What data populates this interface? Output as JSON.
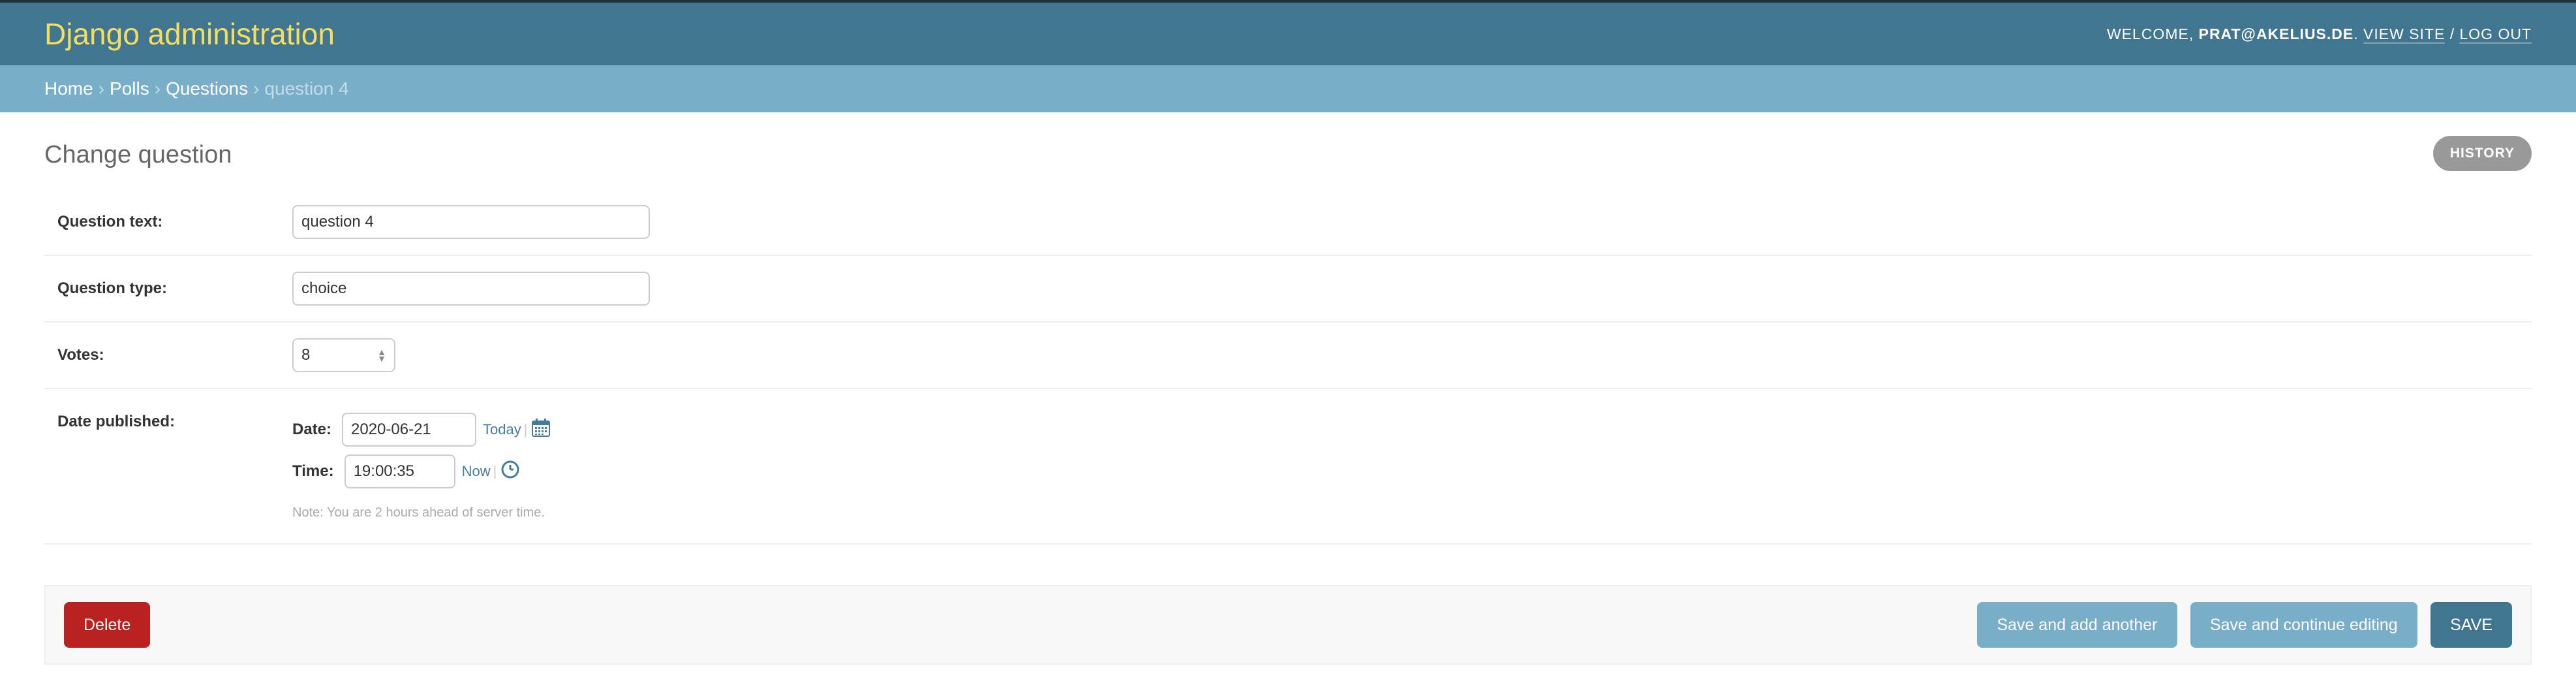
{
  "header": {
    "title": "Django administration",
    "welcome": "Welcome,",
    "user": "prat@akelius.de",
    "view_site": "View site",
    "separator": "/",
    "log_out": "Log out"
  },
  "breadcrumbs": {
    "items": [
      "Home",
      "Polls",
      "Questions"
    ],
    "separator": "›",
    "current": "question 4"
  },
  "page": {
    "title": "Change question",
    "history": "History"
  },
  "form": {
    "question_text": {
      "label": "Question text:",
      "value": "question 4"
    },
    "question_type": {
      "label": "Question type:",
      "value": "choice"
    },
    "votes": {
      "label": "Votes:",
      "value": "8"
    },
    "date_published": {
      "label": "Date published:",
      "date_label": "Date:",
      "date_value": "2020-06-21",
      "today": "Today",
      "pipe": "|",
      "time_label": "Time:",
      "time_value": "19:00:35",
      "now": "Now",
      "note": "Note: You are 2 hours ahead of server time."
    }
  },
  "submit_row": {
    "delete": "Delete",
    "save_add_another": "Save and add another",
    "save_continue": "Save and continue editing",
    "save": "SAVE"
  },
  "colors": {
    "header_bg": "#417690",
    "branding": "#f5dd5d",
    "breadcrumbs_bg": "#79aec8",
    "delete_bg": "#ba2121",
    "link": "#447e9b"
  },
  "icons": [
    "calendar-icon",
    "clock-icon",
    "spinner-arrows-icon"
  ]
}
